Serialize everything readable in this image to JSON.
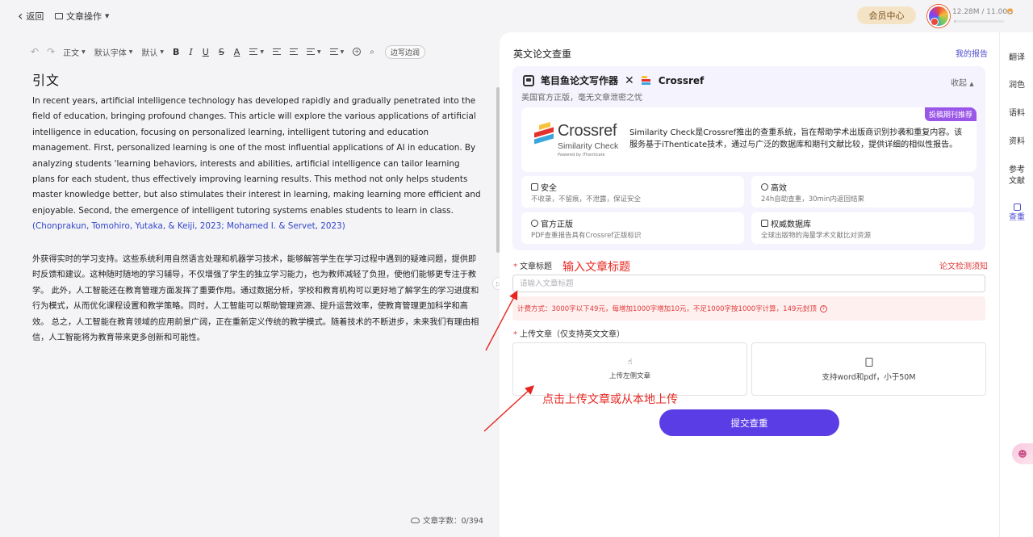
{
  "topbar": {
    "back_label": "返回",
    "doc_ops_label": "文章操作",
    "member_label": "会员中心",
    "storage_text": "12.28M / 11.00G",
    "storage_used_fraction": 0.001
  },
  "editor": {
    "toolbar": {
      "style": "正文",
      "font": "默认字体",
      "size": "默认",
      "bold": "B",
      "italic": "I",
      "underline": "U",
      "strike": "S",
      "color": "A",
      "margin": "边写边润"
    },
    "title": "引文",
    "para_en": "In recent years, artificial intelligence technology has developed rapidly and gradually penetrated into the field of education, bringing profound changes. This article will explore the various applications of artificial intelligence in education, focusing on personalized learning, intelligent tutoring and education management. First, personalized learning is one of the most influential applications of AI in education. By analyzing students 'learning behaviors, interests and abilities, artificial intelligence can tailor learning plans for each student, thus effectively improving learning results. This method not only helps students master knowledge better, but also stimulates their interest in learning, making learning more efficient and enjoyable. Second, the emergence of intelligent tutoring systems enables students to learn in class.",
    "citation": "(Chonprakun, Tomohiro, Yutaka, & Keiji, 2023; Mohamed I. & Servet, 2023)",
    "para_zh": "外获得实时的学习支持。这些系统利用自然语言处理和机器学习技术，能够解答学生在学习过程中遇到的疑难问题，提供即时反馈和建议。这种随时随地的学习辅导，不仅增强了学生的独立学习能力，也为教师减轻了负担，使他们能够更专注于教学。 此外，人工智能还在教育管理方面发挥了重要作用。通过数据分析，学校和教育机构可以更好地了解学生的学习进度和行为模式，从而优化课程设置和教学策略。同时，人工智能可以帮助管理资源、提升运营效率，使教育管理更加科学和高效。 总之，人工智能在教育领域的应用前景广阔，正在重新定义传统的教学模式。随着技术的不断进步，未来我们有理由相信，人工智能将为教育带来更多创新和可能性。",
    "wordcount": "文章字数：0/394"
  },
  "panel": {
    "title": "英文论文查重",
    "my_report": "我的报告",
    "service": {
      "name_a": "笔目鱼论文写作器",
      "x": "✕",
      "name_b": "Crossref",
      "collapse": "收起",
      "subtitle": "美国官方正版，毫无文章泄密之忧",
      "badge": "投稿期刊推荐",
      "logo_word": "Crossref",
      "logo_sub": "Similarity Check",
      "logo_pow": "Powered by iThenticate",
      "description": "Similarity Check是Crossref推出的查重系统，旨在帮助学术出版商识别抄袭和重复内容。该服务基于iThenticate技术，通过与广泛的数据库和期刊文献比较，提供详细的相似性报告。",
      "features": [
        {
          "title": "安全",
          "desc": "不收录，不留痕，不泄露，保证安全"
        },
        {
          "title": "高效",
          "desc": "24h自助查重，30min内返回结果"
        },
        {
          "title": "官方正版",
          "desc": "PDF查重报告具有Crossref正版标识"
        },
        {
          "title": "权威数据库",
          "desc": "全球出版物的海量学术文献比对资源"
        }
      ]
    },
    "title_label": "文章标题",
    "notice_link": "论文检测须知",
    "title_placeholder": "请输入文章标题",
    "title_value": "",
    "price_text": "计费方式：3000字以下49元，每增加1000字增加10元，不足1000字按1000字计算，149元封顶",
    "upload_label": "上传文章（仅支持英文文章）",
    "upload_left": "上传左侧文章",
    "upload_right": "支持word和pdf，小于50M",
    "submit": "提交查重"
  },
  "sidebar": {
    "items": [
      "翻译",
      "润色",
      "语料",
      "资料",
      "参考文献",
      "查重"
    ],
    "active": "查重"
  },
  "annotations": {
    "title_hint": "输入文章标题",
    "upload_hint": "点击上传文章或从本地上传"
  },
  "colors": {
    "accent": "#5b3de6",
    "link": "#4d4dd1",
    "annotation": "#e8261f",
    "crossref_red": "#e4312b",
    "crossref_yellow": "#f7c33d",
    "crossref_blue": "#3aa6dd"
  }
}
